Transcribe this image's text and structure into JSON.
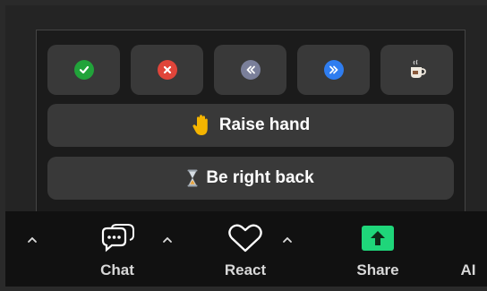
{
  "reactions": {
    "quick": [
      {
        "name": "yes",
        "icon": "green-check-icon",
        "color": "#21a33a"
      },
      {
        "name": "no",
        "icon": "red-x-icon",
        "color": "#e0453a"
      },
      {
        "name": "slow-down",
        "icon": "slow-down-icon",
        "color": "#7a7f9a"
      },
      {
        "name": "speed-up",
        "icon": "speed-up-icon",
        "color": "#2f7df0"
      },
      {
        "name": "coffee",
        "icon": "coffee-cup-icon",
        "color": "#e8e0d4"
      }
    ],
    "raise_hand_label": "Raise hand",
    "raise_hand_icon": "raised-hand-icon",
    "be_right_back_label": "Be right back",
    "be_right_back_icon": "hourglass-icon"
  },
  "toolbar": {
    "chat_label": "Chat",
    "react_label": "React",
    "share_label": "Share",
    "ai_label": "AI",
    "share_color": "#1fd67a"
  }
}
